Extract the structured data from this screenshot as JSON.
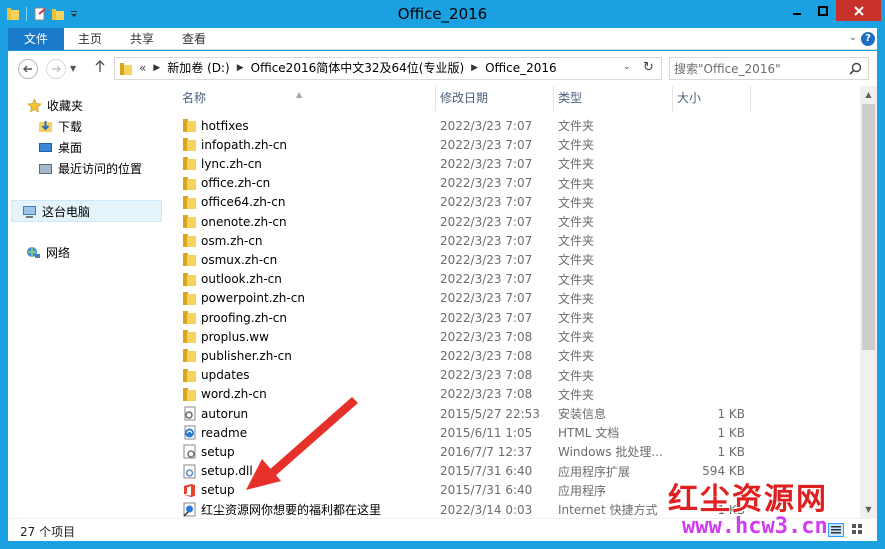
{
  "window": {
    "title": "Office_2016"
  },
  "ribbon": {
    "tabs": [
      "文件",
      "主页",
      "共享",
      "查看"
    ]
  },
  "address": {
    "crumbs": [
      "新加卷 (D:)",
      "Office2016简体中文32及64位(专业版)",
      "Office_2016"
    ],
    "overflow": "«"
  },
  "search": {
    "placeholder": "搜索\"Office_2016\""
  },
  "navpane": {
    "favorites": "收藏夹",
    "downloads": "下载",
    "desktop": "桌面",
    "recent": "最近访问的位置",
    "thispc": "这台电脑",
    "network": "网络"
  },
  "columns": {
    "name": "名称",
    "date": "修改日期",
    "type": "类型",
    "size": "大小"
  },
  "files": [
    {
      "name": "hotfixes",
      "date": "2022/3/23 7:07",
      "type": "文件夹",
      "size": "",
      "icon": "folder"
    },
    {
      "name": "infopath.zh-cn",
      "date": "2022/3/23 7:07",
      "type": "文件夹",
      "size": "",
      "icon": "folder"
    },
    {
      "name": "lync.zh-cn",
      "date": "2022/3/23 7:07",
      "type": "文件夹",
      "size": "",
      "icon": "folder"
    },
    {
      "name": "office.zh-cn",
      "date": "2022/3/23 7:07",
      "type": "文件夹",
      "size": "",
      "icon": "folder"
    },
    {
      "name": "office64.zh-cn",
      "date": "2022/3/23 7:07",
      "type": "文件夹",
      "size": "",
      "icon": "folder"
    },
    {
      "name": "onenote.zh-cn",
      "date": "2022/3/23 7:07",
      "type": "文件夹",
      "size": "",
      "icon": "folder"
    },
    {
      "name": "osm.zh-cn",
      "date": "2022/3/23 7:07",
      "type": "文件夹",
      "size": "",
      "icon": "folder"
    },
    {
      "name": "osmux.zh-cn",
      "date": "2022/3/23 7:07",
      "type": "文件夹",
      "size": "",
      "icon": "folder"
    },
    {
      "name": "outlook.zh-cn",
      "date": "2022/3/23 7:07",
      "type": "文件夹",
      "size": "",
      "icon": "folder"
    },
    {
      "name": "powerpoint.zh-cn",
      "date": "2022/3/23 7:07",
      "type": "文件夹",
      "size": "",
      "icon": "folder"
    },
    {
      "name": "proofing.zh-cn",
      "date": "2022/3/23 7:07",
      "type": "文件夹",
      "size": "",
      "icon": "folder"
    },
    {
      "name": "proplus.ww",
      "date": "2022/3/23 7:08",
      "type": "文件夹",
      "size": "",
      "icon": "folder"
    },
    {
      "name": "publisher.zh-cn",
      "date": "2022/3/23 7:08",
      "type": "文件夹",
      "size": "",
      "icon": "folder"
    },
    {
      "name": "updates",
      "date": "2022/3/23 7:08",
      "type": "文件夹",
      "size": "",
      "icon": "folder"
    },
    {
      "name": "word.zh-cn",
      "date": "2022/3/23 7:08",
      "type": "文件夹",
      "size": "",
      "icon": "folder"
    },
    {
      "name": "autorun",
      "date": "2015/5/27 22:53",
      "type": "安装信息",
      "size": "1 KB",
      "icon": "inf"
    },
    {
      "name": "readme",
      "date": "2015/6/11 1:05",
      "type": "HTML 文档",
      "size": "1 KB",
      "icon": "html"
    },
    {
      "name": "setup",
      "date": "2016/7/7 12:37",
      "type": "Windows 批处理...",
      "size": "1 KB",
      "icon": "bat"
    },
    {
      "name": "setup.dll",
      "date": "2015/7/31 6:40",
      "type": "应用程序扩展",
      "size": "594 KB",
      "icon": "dll"
    },
    {
      "name": "setup",
      "date": "2015/7/31 6:40",
      "type": "应用程序",
      "size": "",
      "icon": "office"
    },
    {
      "name": "红尘资源网你想要的福利都在这里",
      "date": "2022/3/14 0:03",
      "type": "Internet 快捷方式",
      "size": "1 KB",
      "icon": "url"
    }
  ],
  "status": {
    "count": "27 个项目"
  },
  "watermark": {
    "cn": "红尘资源网",
    "url": "www.hcw3.cn"
  },
  "colors": {
    "titlebar": "#1ba1e2",
    "file_tab": "#1979ca",
    "close": "#c7312a",
    "arrow": "#e8302a"
  }
}
